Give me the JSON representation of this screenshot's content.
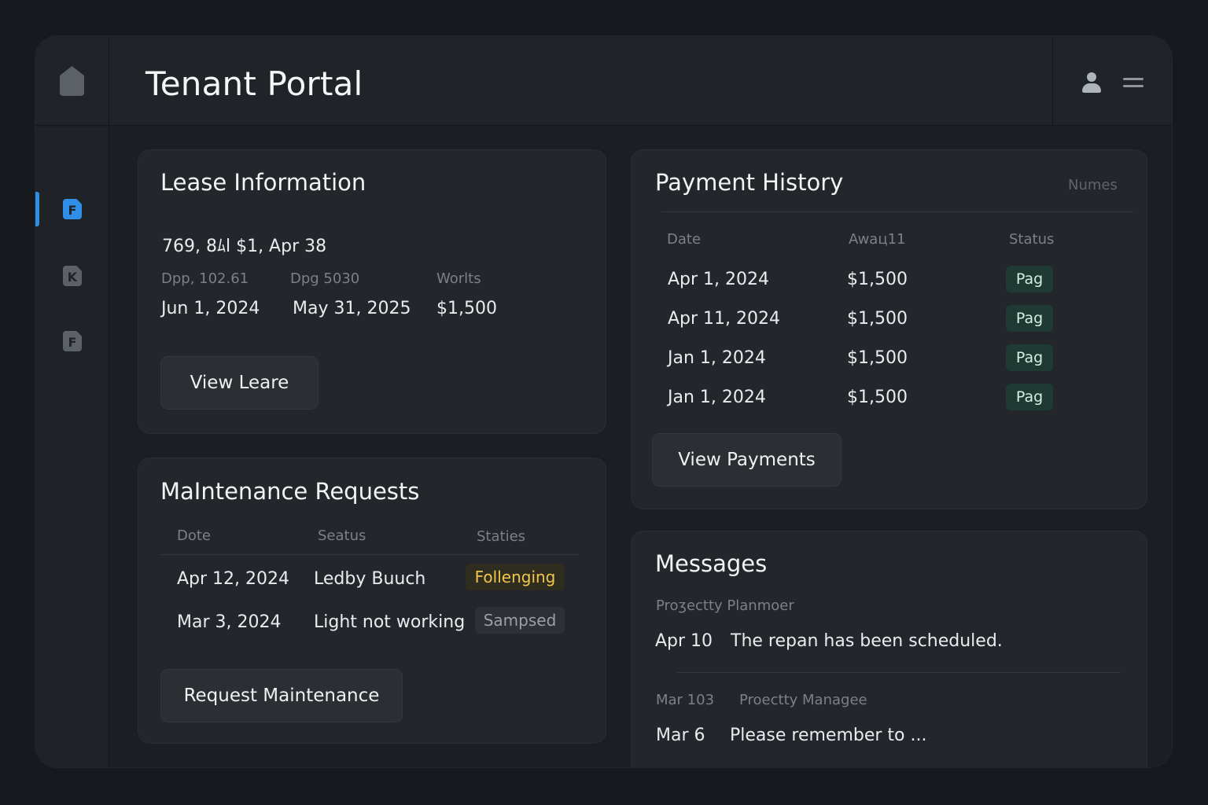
{
  "header": {
    "title": "Tenant Portal"
  },
  "sidebar": {
    "items": [
      {
        "label": "F",
        "color": "#2f8fe8",
        "active": true
      },
      {
        "label": "K",
        "color": "#5c6168",
        "active": false
      },
      {
        "label": "F",
        "color": "#5c6168",
        "active": false
      }
    ]
  },
  "lease": {
    "title": "Lease Information",
    "summary": "769, 8ﾑl $1, Apr 38",
    "fields": [
      {
        "label": "Dpp, 102.61",
        "value": "Jun 1, 2024"
      },
      {
        "label": "Dpg 5030",
        "value": "May 31, 2025"
      },
      {
        "label": "Worlts",
        "value": "$1,500"
      }
    ],
    "button": "View Leare"
  },
  "maintenance": {
    "title": "MaIntenance Requests",
    "columns": [
      "Dote",
      "Seatus",
      "Staties"
    ],
    "rows": [
      {
        "date": "Apr 12, 2024",
        "desc": "Ledby Buuch",
        "status": "Follenging",
        "status_color": "#f1c84b",
        "status_bg": "#2f2c20"
      },
      {
        "date": "Mar 3, 2024",
        "desc": "Light not working",
        "status": "Sampsed",
        "status_color": "#9aa0a6",
        "status_bg": "#2d3035"
      }
    ],
    "button": "Request Maintenance"
  },
  "payments": {
    "title": "Payment History",
    "filter": "Numes",
    "columns": [
      "Date",
      "Awaц11",
      "Status"
    ],
    "rows": [
      {
        "date": "Apr 1, 2024",
        "amount": "$1,500",
        "status": "Pag"
      },
      {
        "date": "Apr 11, 2024",
        "amount": "$1,500",
        "status": "Pag"
      },
      {
        "date": "Jan 1, 2024",
        "amount": "$1,500",
        "status": "Pag"
      },
      {
        "date": "Jan 1, 2024",
        "amount": "$1,500",
        "status": "Pag"
      }
    ],
    "button": "View Payments"
  },
  "messages": {
    "title": "Messages",
    "items": [
      {
        "meta_date": "",
        "sender": "Proʒectty Planmoer",
        "date": "Apr 10",
        "text": "The repan has been scheduled."
      },
      {
        "meta_date": "Mar 103",
        "sender": "Proectty Managee",
        "date": "Mar 6",
        "text": "Please remember to ..."
      }
    ]
  },
  "colors": {
    "accent": "#2f8fe8",
    "paid_bg": "#1e3a33",
    "pending": "#f1c84b"
  }
}
